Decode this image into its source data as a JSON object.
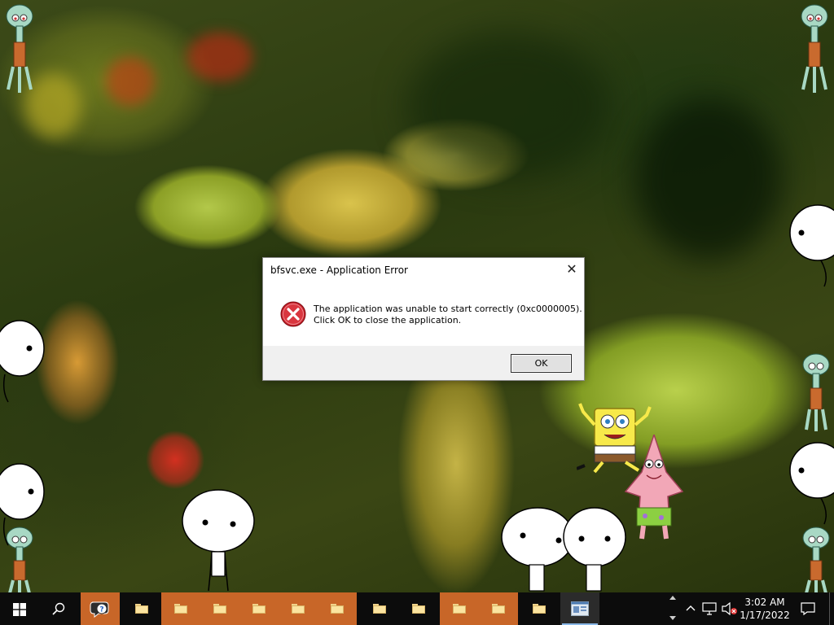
{
  "dialog": {
    "title": "bfsvc.exe - Application Error",
    "close_glyph": "✕",
    "message_line1": "The application was unable to start correctly (0xc0000005).",
    "message_line2": "Click OK to close the application.",
    "ok_label": "OK",
    "icon": "error-icon"
  },
  "taskbar": {
    "start_icon": "windows-logo-icon",
    "search_icon": "search-icon",
    "apps": [
      {
        "icon": "help-chat-icon",
        "style": "orange"
      },
      {
        "icon": "file-explorer-icon",
        "style": "dark"
      },
      {
        "icon": "file-explorer-icon",
        "style": "orange"
      },
      {
        "icon": "file-explorer-icon",
        "style": "orange"
      },
      {
        "icon": "file-explorer-icon",
        "style": "orange"
      },
      {
        "icon": "file-explorer-icon",
        "style": "orange"
      },
      {
        "icon": "file-explorer-icon",
        "style": "orange"
      },
      {
        "icon": "file-explorer-icon",
        "style": "dark"
      },
      {
        "icon": "file-explorer-icon",
        "style": "dark"
      },
      {
        "icon": "file-explorer-icon",
        "style": "orange"
      },
      {
        "icon": "file-explorer-icon",
        "style": "orange"
      },
      {
        "icon": "file-explorer-icon",
        "style": "dark"
      },
      {
        "icon": "application-window-icon",
        "style": "active"
      }
    ],
    "tray": {
      "time": "3:02 AM",
      "date": "1/17/2022",
      "icons": [
        "show-hidden-icons-chevron",
        "network-icon",
        "volume-muted-icon",
        "notification-icon"
      ]
    }
  },
  "colors": {
    "taskbar_bg": "#0c0c0c",
    "orange_app": "#c86628",
    "dialog_bg": "#ffffff",
    "button_bar": "#f0f0f0"
  }
}
